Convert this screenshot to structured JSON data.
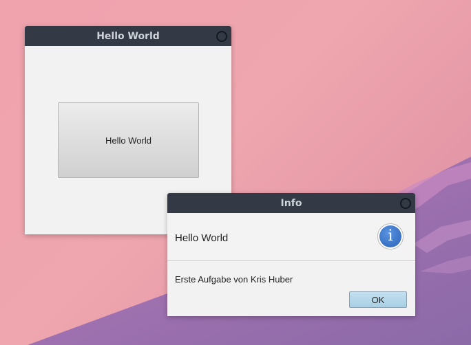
{
  "main_window": {
    "title": "Hello World",
    "button_label": "Hello World"
  },
  "info_dialog": {
    "title": "Info",
    "header_text": "Hello World",
    "content_text": "Erste Aufgabe von Kris Huber",
    "ok_label": "OK",
    "icon": "info-icon"
  },
  "colors": {
    "titlebar": "#333a46",
    "window_bg": "#f2f2f2",
    "ok_button": "#b4d7ea",
    "info_icon": "#3a72c8"
  }
}
